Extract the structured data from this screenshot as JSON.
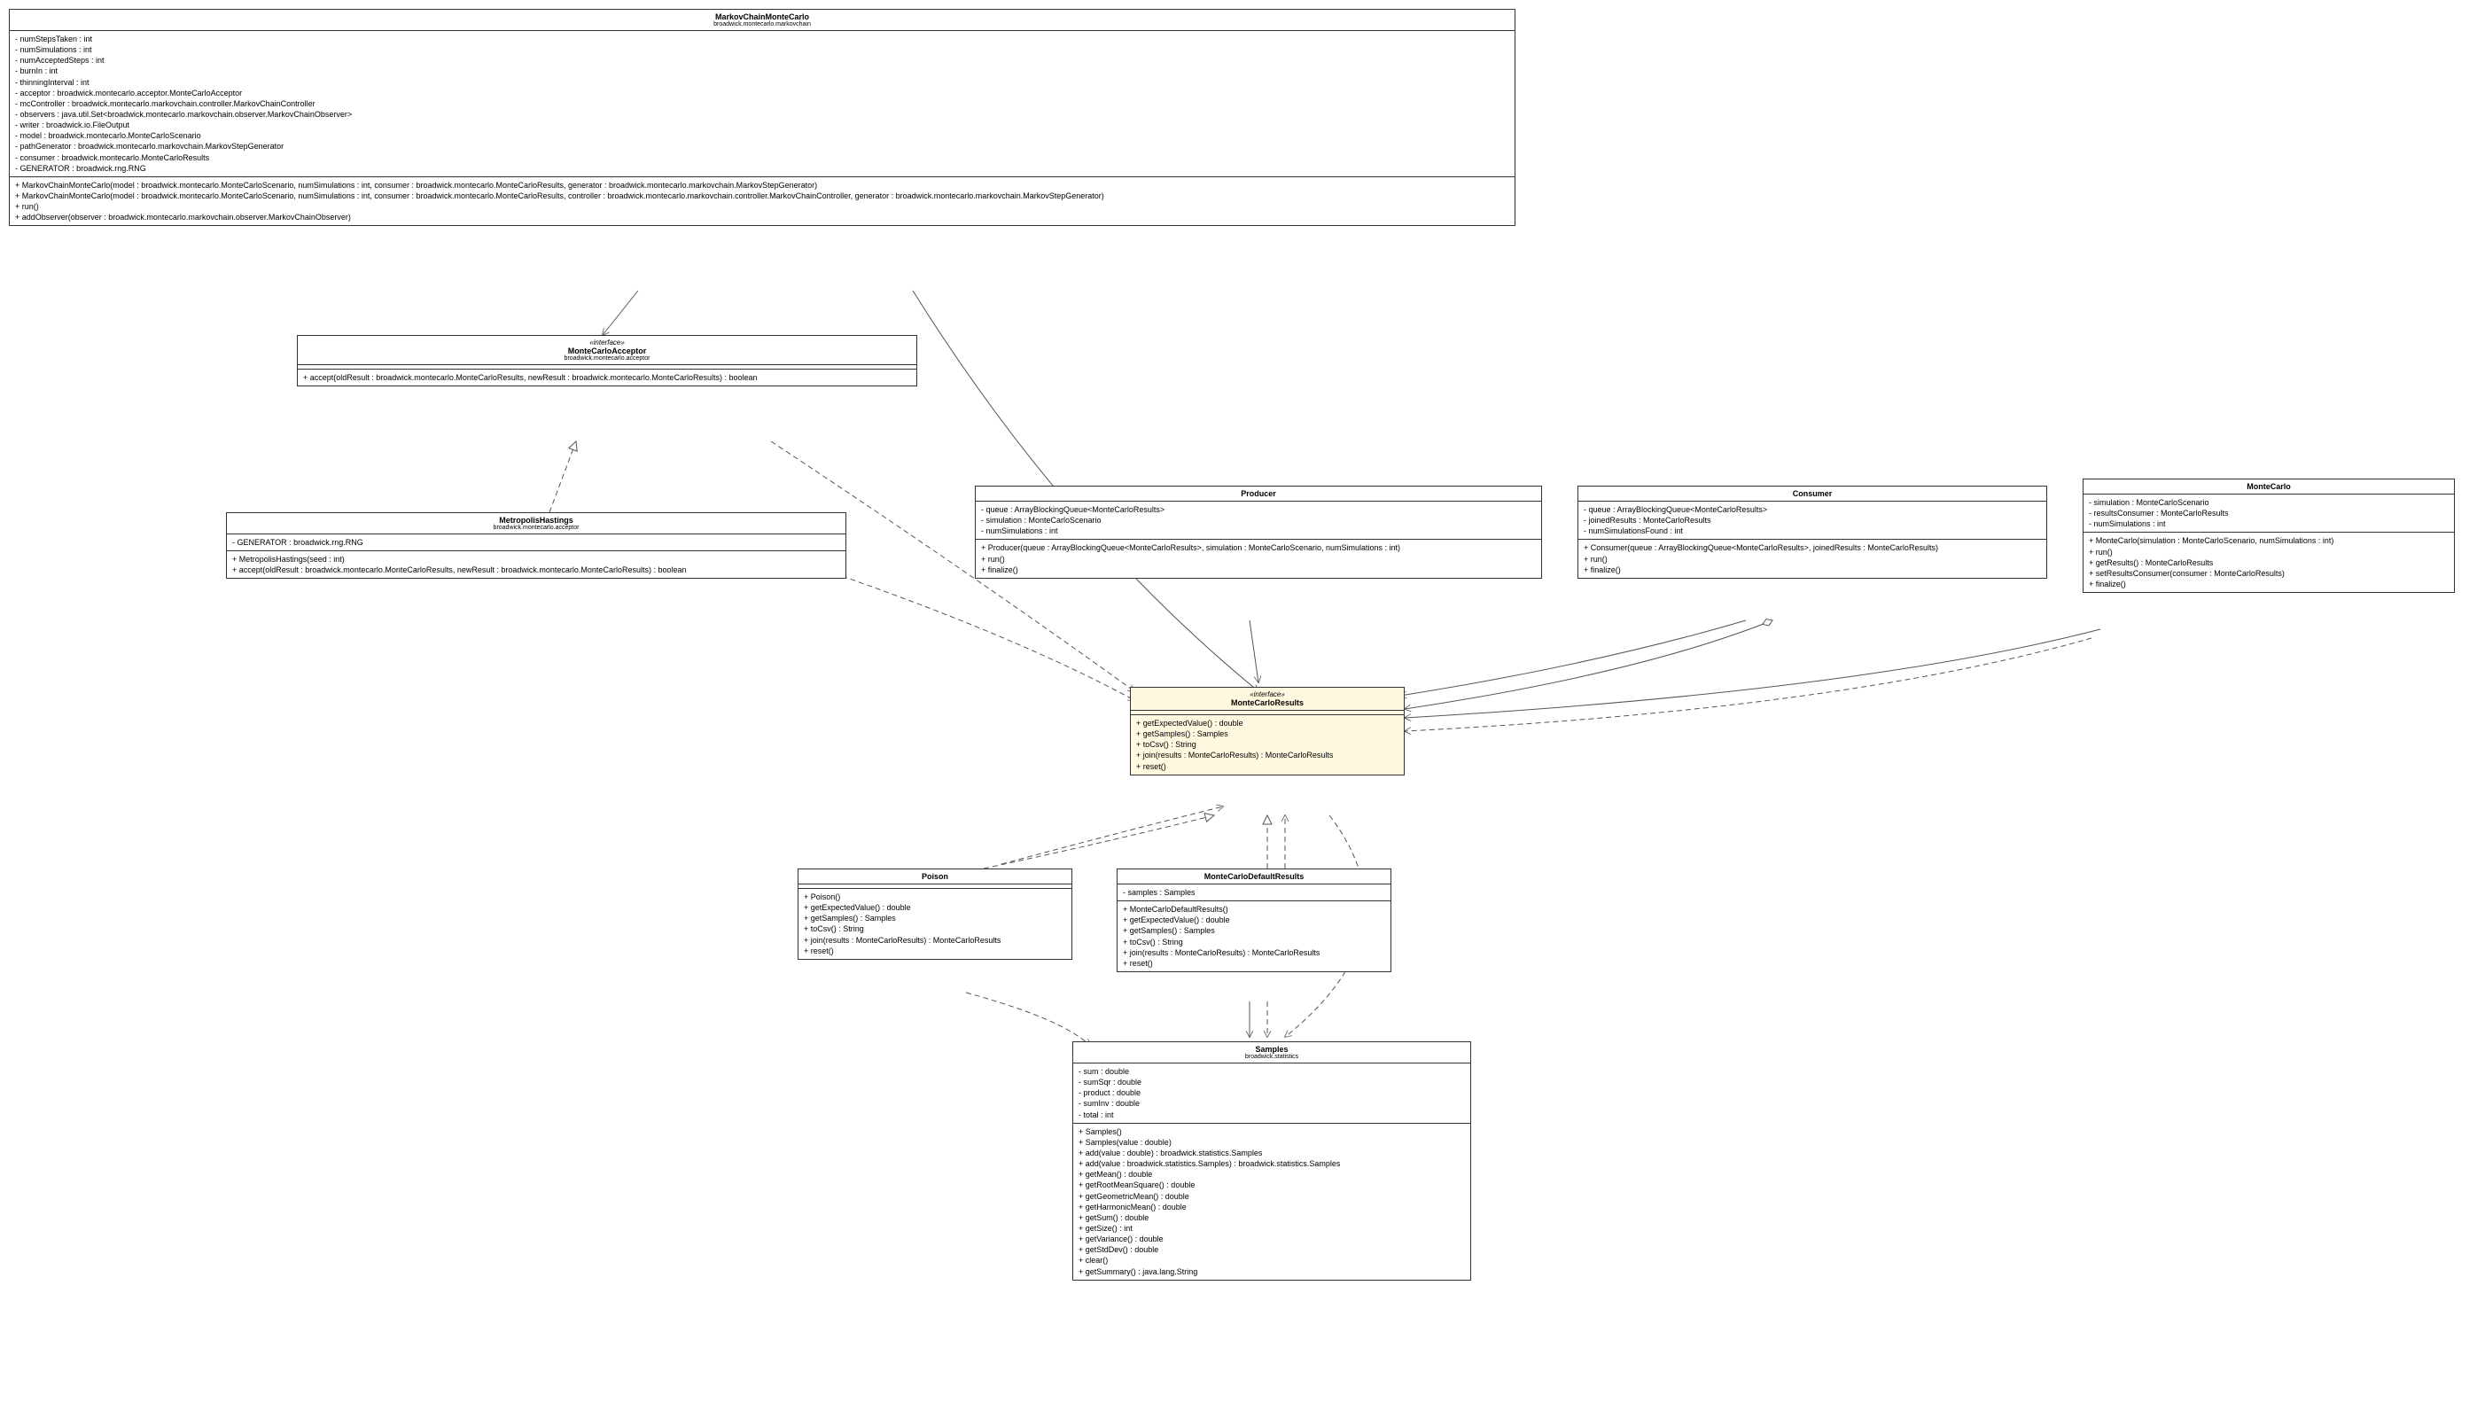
{
  "classes": {
    "markovChainMonteCarlo": {
      "name": "MarkovChainMonteCarlo",
      "package": "broadwick.montecarlo.markovchain",
      "attributes": [
        "- numStepsTaken : int",
        "- numSimulations : int",
        "- numAcceptedSteps : int",
        "- burnIn : int",
        "- thinningInterval : int",
        "- acceptor : broadwick.montecarlo.acceptor.MonteCarloAcceptor",
        "- mcController : broadwick.montecarlo.markovchain.controller.MarkovChainController",
        "- observers : java.util.Set<broadwick.montecarlo.markovchain.observer.MarkovChainObserver>",
        "- writer : broadwick.io.FileOutput",
        "- model : broadwick.montecarlo.MonteCarloScenario",
        "- pathGenerator : broadwick.montecarlo.markovchain.MarkovStepGenerator",
        "- consumer : broadwick.montecarlo.MonteCarloResults",
        "- GENERATOR : broadwick.rng.RNG"
      ],
      "operations": [
        "+ MarkovChainMonteCarlo(model : broadwick.montecarlo.MonteCarloScenario, numSimulations : int, consumer : broadwick.montecarlo.MonteCarloResults, generator : broadwick.montecarlo.markovchain.MarkovStepGenerator)",
        "+ MarkovChainMonteCarlo(model : broadwick.montecarlo.MonteCarloScenario, numSimulations : int, consumer : broadwick.montecarlo.MonteCarloResults, controller : broadwick.montecarlo.markovchain.controller.MarkovChainController, generator : broadwick.montecarlo.markovchain.MarkovStepGenerator)",
        "+ run()",
        "+ addObserver(observer : broadwick.montecarlo.markovchain.observer.MarkovChainObserver)"
      ]
    },
    "monteCarloAcceptor": {
      "stereotype": "«interface»",
      "name": "MonteCarloAcceptor",
      "package": "broadwick.montecarlo.acceptor",
      "operations": [
        "+ accept(oldResult : broadwick.montecarlo.MonteCarloResults, newResult : broadwick.montecarlo.MonteCarloResults) : boolean"
      ]
    },
    "metropolisHastings": {
      "name": "MetropolisHastings",
      "package": "broadwick.montecarlo.acceptor",
      "attributes": [
        "- GENERATOR : broadwick.rng.RNG"
      ],
      "operations": [
        "+ MetropolisHastings(seed : int)",
        "+ accept(oldResult : broadwick.montecarlo.MonteCarloResults, newResult : broadwick.montecarlo.MonteCarloResults) : boolean"
      ]
    },
    "producer": {
      "name": "Producer",
      "attributes": [
        "- queue : ArrayBlockingQueue<MonteCarloResults>",
        "- simulation : MonteCarloScenario",
        "- numSimulations : int"
      ],
      "operations": [
        "+ Producer(queue : ArrayBlockingQueue<MonteCarloResults>, simulation : MonteCarloScenario, numSimulations : int)",
        "+ run()",
        "+ finalize()"
      ]
    },
    "consumer": {
      "name": "Consumer",
      "attributes": [
        "- queue : ArrayBlockingQueue<MonteCarloResults>",
        "- joinedResults : MonteCarloResults",
        "- numSimulationsFound : int"
      ],
      "operations": [
        "+ Consumer(queue : ArrayBlockingQueue<MonteCarloResults>, joinedResults : MonteCarloResults)",
        "+ run()",
        "+ finalize()"
      ]
    },
    "monteCarlo": {
      "name": "MonteCarlo",
      "attributes": [
        "- simulation : MonteCarloScenario",
        "- resultsConsumer : MonteCarloResults",
        "- numSimulations : int"
      ],
      "operations": [
        "+ MonteCarlo(simulation : MonteCarloScenario, numSimulations : int)",
        "+ run()",
        "+ getResults() : MonteCarloResults",
        "+ setResultsConsumer(consumer : MonteCarloResults)",
        "+ finalize()"
      ]
    },
    "monteCarloResults": {
      "stereotype": "«interface»",
      "name": "MonteCarloResults",
      "operations": [
        "+ getExpectedValue() : double",
        "+ getSamples() : Samples",
        "+ toCsv() : String",
        "+ join(results : MonteCarloResults) : MonteCarloResults",
        "+ reset()"
      ]
    },
    "poison": {
      "name": "Poison",
      "operations": [
        "+ Poison()",
        "+ getExpectedValue() : double",
        "+ getSamples() : Samples",
        "+ toCsv() : String",
        "+ join(results : MonteCarloResults) : MonteCarloResults",
        "+ reset()"
      ]
    },
    "monteCarloDefaultResults": {
      "name": "MonteCarloDefaultResults",
      "attributes": [
        "- samples : Samples"
      ],
      "operations": [
        "+ MonteCarloDefaultResults()",
        "+ getExpectedValue() : double",
        "+ getSamples() : Samples",
        "+ toCsv() : String",
        "+ join(results : MonteCarloResults) : MonteCarloResults",
        "+ reset()"
      ]
    },
    "samples": {
      "name": "Samples",
      "package": "broadwick.statistics",
      "attributes": [
        "- sum : double",
        "- sumSqr : double",
        "- product : double",
        "- sumInv : double",
        "- total : int"
      ],
      "operations": [
        "+ Samples()",
        "+ Samples(value : double)",
        "+ add(value : double) : broadwick.statistics.Samples",
        "+ add(value : broadwick.statistics.Samples) : broadwick.statistics.Samples",
        "+ getMean() : double",
        "+ getRootMeanSquare() : double",
        "+ getGeometricMean() : double",
        "+ getHarmonicMean() : double",
        "+ getSum() : double",
        "+ getSize() : int",
        "+ getVariance() : double",
        "+ getStdDev() : double",
        "+ clear()",
        "+ getSummary() : java.lang.String"
      ]
    }
  }
}
